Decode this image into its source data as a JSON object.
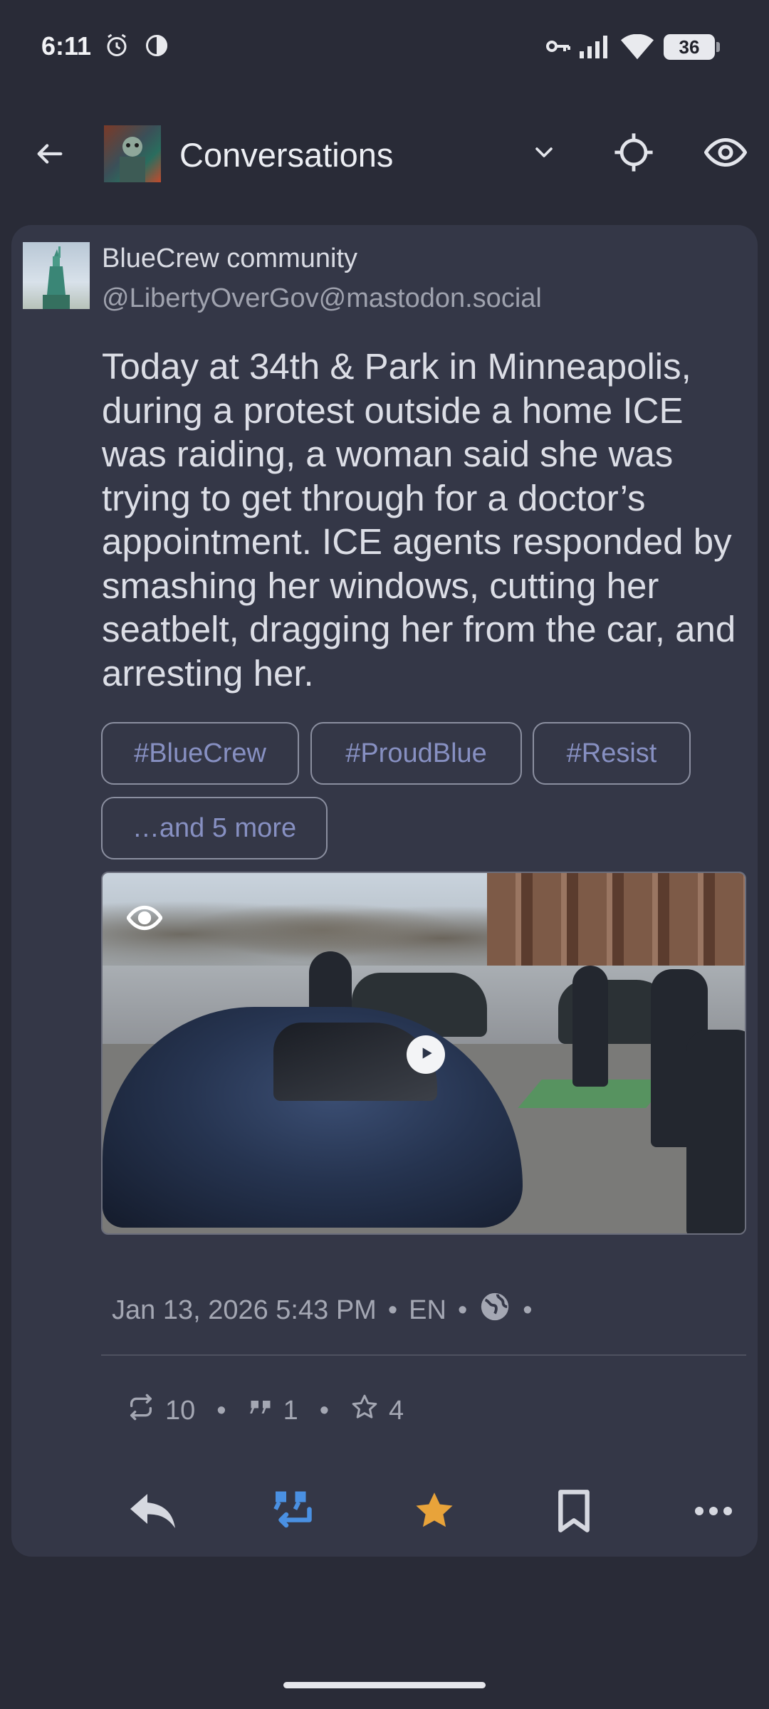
{
  "status_bar": {
    "time": "6:11",
    "battery": "36"
  },
  "app_bar": {
    "title": "Conversations"
  },
  "post": {
    "display_name": "BlueCrew community",
    "handle": "@LibertyOverGov@mastodon.social",
    "text": "Today at 34th & Park in Minneapolis, during a protest outside a home ICE was raiding, a woman said she was trying to get through for a doctor’s appointment. ICE agents responded by smashing her windows, cutting her seatbelt, dragging her from the car, and arresting her.",
    "tags": [
      "#BlueCrew",
      "#ProudBlue",
      "#Resist"
    ],
    "more_tags": "…and 5 more",
    "timestamp": "Jan 13, 2026 5:43 PM",
    "language": "EN",
    "separator": "•",
    "visibility_icon": "globe-icon"
  },
  "stats": {
    "boosts": "10",
    "quotes": "1",
    "favourites": "4"
  },
  "colors": {
    "boost_active": "#4a90e2",
    "favourite_active": "#e8a33a",
    "tag_text": "#8790c2"
  },
  "icons": [
    "back-arrow-icon",
    "chevron-down-icon",
    "crosshair-icon",
    "eye-icon",
    "reply-icon",
    "boost-icon",
    "star-icon",
    "bookmark-icon",
    "more-icon",
    "play-icon"
  ]
}
